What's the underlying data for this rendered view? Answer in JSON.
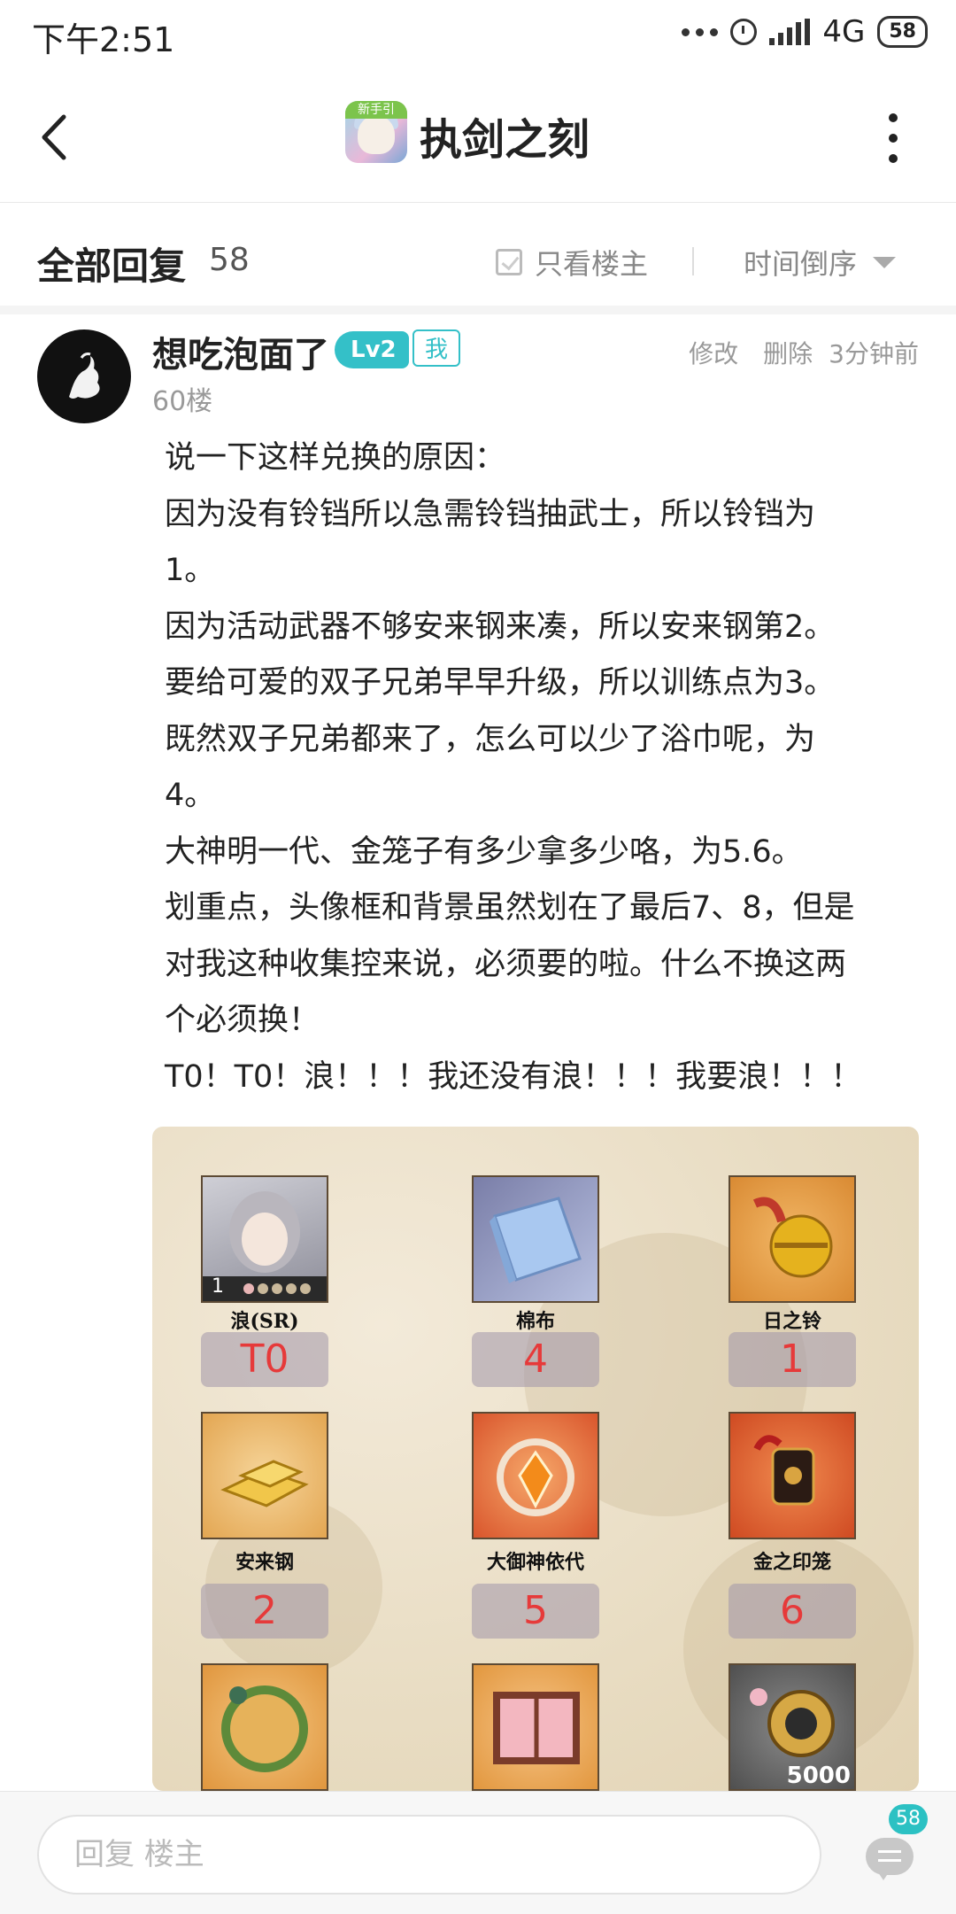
{
  "status_bar": {
    "time": "下午2:51",
    "network": "4G",
    "battery": "58"
  },
  "header": {
    "title": "执剑之刻",
    "app_icon_tag": "新手引"
  },
  "reply_bar": {
    "title": "全部回复",
    "count": "58",
    "only_op_label": "只看楼主",
    "sort_label": "时间倒序"
  },
  "post": {
    "username": "想吃泡面了",
    "level": "Lv2",
    "me_badge": "我",
    "floor": "60楼",
    "edit": "修改",
    "delete": "删除",
    "time": "3分钟前",
    "lines": [
      "说一下这样兑换的原因：",
      "因为没有铃铛所以急需铃铛抽武士，所以铃铛为",
      "1。",
      "因为活动武器不够安来钢来凑，所以安来钢第2。",
      "要给可爱的双子兄弟早早升级，所以训练点为3。",
      "既然双子兄弟都来了，怎么可以少了浴巾呢，为",
      "4。",
      "大神明一代、金笼子有多少拿多少咯，为5.6。",
      "划重点，头像框和背景虽然划在了最后7、8，但是",
      "对我这种收集控来说，必须要的啦。什么不换这两",
      "个必须换！",
      "T0！T0！浪！！！我还没有浪！！！我要浪！！！"
    ]
  },
  "image_card": {
    "items": [
      {
        "label": "浪(SR)",
        "rank": "T0",
        "icon": "character-portrait-icon",
        "level": "1"
      },
      {
        "label": "棉布",
        "rank": "4",
        "icon": "towel-icon"
      },
      {
        "label": "日之铃",
        "rank": "1",
        "icon": "bell-icon"
      },
      {
        "label": "安来钢",
        "rank": "2",
        "icon": "gold-ingot-icon"
      },
      {
        "label": "大御神依代",
        "rank": "5",
        "icon": "orange-gem-icon"
      },
      {
        "label": "金之印笼",
        "rank": "6",
        "icon": "inro-case-icon"
      },
      {
        "label": "",
        "rank": "",
        "icon": "bamboo-frame-icon"
      },
      {
        "label": "",
        "rank": "",
        "icon": "window-background-icon"
      },
      {
        "label": "",
        "rank": "",
        "icon": "coin-icon",
        "quantity": "5000"
      }
    ]
  },
  "bottom_bar": {
    "reply_placeholder": "回复  楼主",
    "comment_count": "58"
  }
}
